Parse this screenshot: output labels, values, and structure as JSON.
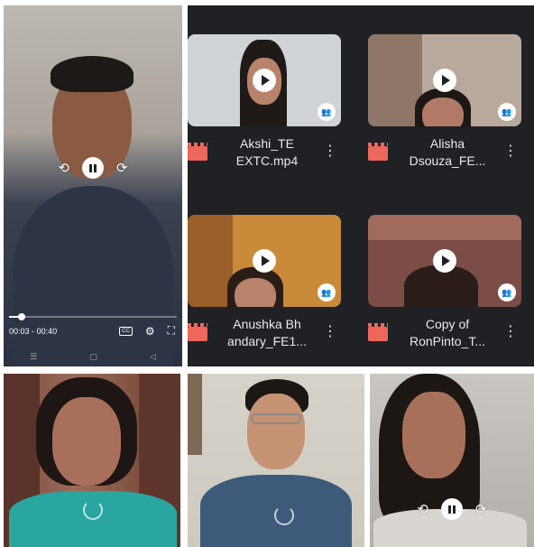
{
  "player": {
    "time_current": "00:03",
    "time_separator": "-",
    "time_total": "00:40",
    "progress_fraction": 0.075,
    "cc_label": "CC"
  },
  "files": [
    {
      "name": "Akshi_TE\nEXTC.mp4",
      "thumb_bg": "#cfd3d6"
    },
    {
      "name": "Alisha\nDsouza_FE...",
      "thumb_bg": "#b9a99c"
    },
    {
      "name": "Anushka Bh\nandary_FE1...",
      "thumb_bg": "#c98a3a"
    },
    {
      "name": "Copy of\nRonPinto_T...",
      "thumb_bg": "#7b4d46"
    }
  ],
  "colors": {
    "grid_bg": "#202124",
    "file_icon": "#ee675c",
    "text_light": "#e8eaed"
  }
}
